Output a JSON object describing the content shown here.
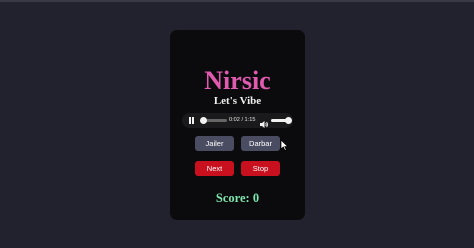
{
  "app": {
    "title": "Nirsic",
    "subtitle": "Let's Vibe"
  },
  "player": {
    "current_time": "0:02",
    "duration": "1:15",
    "time_display": "0:02 / 1:15",
    "progress_fraction": 0.03,
    "volume_fraction": 1.0,
    "play_state_icon": "pause-icon",
    "volume_icon": "speaker-icon"
  },
  "buttons": {
    "track1": "Jailer",
    "track2": "Darbar",
    "next": "Next",
    "stop": "Stop"
  },
  "score": {
    "text": "Score: 0"
  },
  "colors": {
    "background": "#22212e",
    "card": "#0b0b0d",
    "title": "#e05ab0",
    "track_button": "#4a4d62",
    "action_button": "#c8101e",
    "score": "#7fe6b0"
  }
}
